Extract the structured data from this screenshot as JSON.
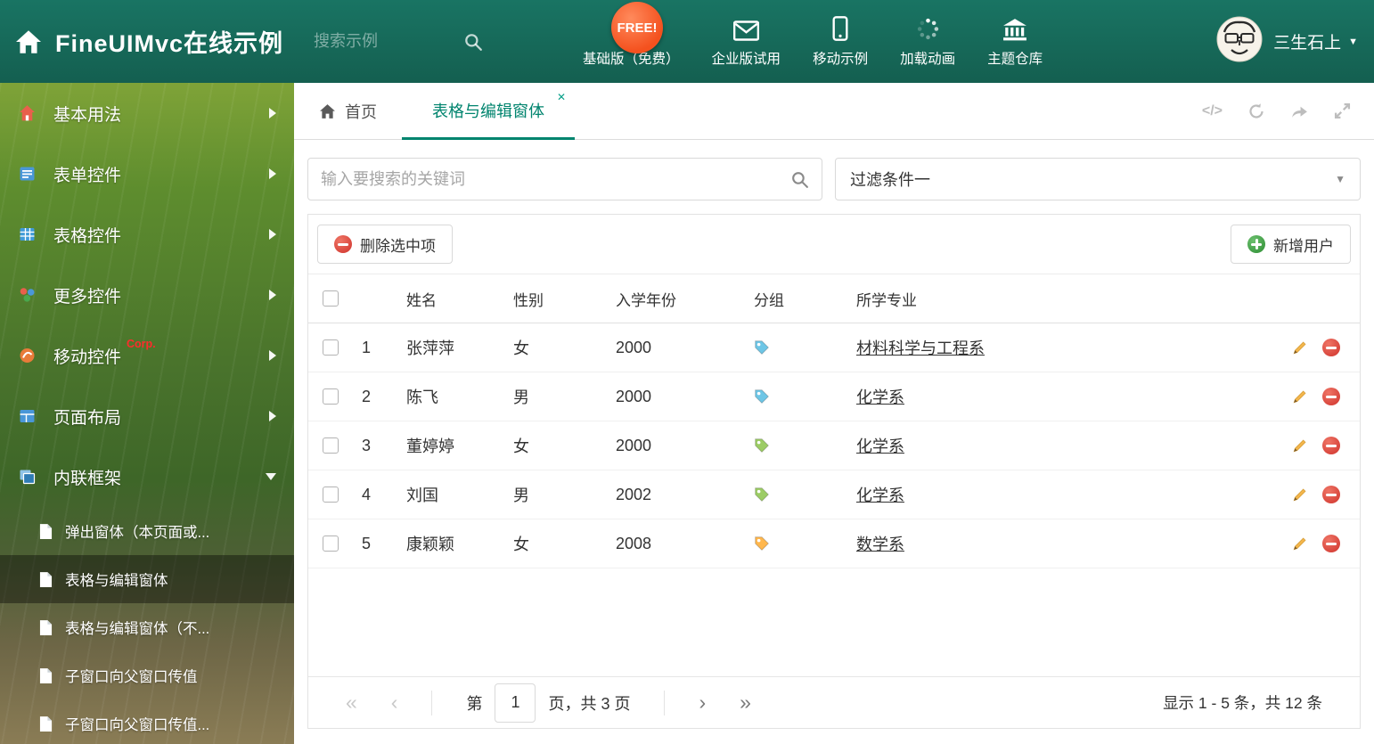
{
  "header": {
    "title": "FineUIMvc在线示例",
    "search_placeholder": "搜索示例",
    "free_badge": "FREE!",
    "nav_items": [
      {
        "label": "基础版（免费）"
      },
      {
        "label": "企业版试用"
      },
      {
        "label": "移动示例"
      },
      {
        "label": "加载动画"
      },
      {
        "label": "主题仓库"
      }
    ],
    "user_name": "三生石上"
  },
  "sidebar": {
    "items": [
      {
        "label": "基本用法"
      },
      {
        "label": "表单控件"
      },
      {
        "label": "表格控件"
      },
      {
        "label": "更多控件"
      },
      {
        "label": "移动控件",
        "badge": "Corp."
      },
      {
        "label": "页面布局"
      },
      {
        "label": "内联框架"
      }
    ],
    "submenu": [
      {
        "label": "弹出窗体（本页面或..."
      },
      {
        "label": "表格与编辑窗体"
      },
      {
        "label": "表格与编辑窗体（不..."
      },
      {
        "label": "子窗口向父窗口传值"
      },
      {
        "label": "子窗口向父窗口传值..."
      }
    ]
  },
  "tabs": {
    "home": "首页",
    "active": "表格与编辑窗体"
  },
  "search": {
    "placeholder": "输入要搜索的关键词",
    "filter_value": "过滤条件一"
  },
  "toolbar": {
    "delete_label": "删除选中项",
    "add_label": "新增用户"
  },
  "table": {
    "columns": [
      "姓名",
      "性别",
      "入学年份",
      "分组",
      "所学专业"
    ],
    "rows": [
      {
        "index": "1",
        "name": "张萍萍",
        "gender": "女",
        "year": "2000",
        "tag_color": "#6ec6e6",
        "major": "材料科学与工程系"
      },
      {
        "index": "2",
        "name": "陈飞",
        "gender": "男",
        "year": "2000",
        "tag_color": "#6ec6e6",
        "major": "化学系"
      },
      {
        "index": "3",
        "name": "董婷婷",
        "gender": "女",
        "year": "2000",
        "tag_color": "#9ccc65",
        "major": "化学系"
      },
      {
        "index": "4",
        "name": "刘国",
        "gender": "男",
        "year": "2002",
        "tag_color": "#9ccc65",
        "major": "化学系"
      },
      {
        "index": "5",
        "name": "康颖颖",
        "gender": "女",
        "year": "2008",
        "tag_color": "#ffb74d",
        "major": "数学系"
      }
    ]
  },
  "pagination": {
    "first": "«",
    "prev": "‹",
    "page_prefix": "第",
    "page_value": "1",
    "page_suffix": "页，共 3 页",
    "next": "›",
    "last": "»",
    "summary": "显示 1 - 5 条，共 12 条"
  },
  "icons": {
    "caret": "▼",
    "code": "</>",
    "close": "✕"
  },
  "colors": {
    "accent": "#00846e",
    "header_green": "#176a5a",
    "delete_red": "#d7433a",
    "add_green": "#3d9a42",
    "link": "#333333"
  }
}
